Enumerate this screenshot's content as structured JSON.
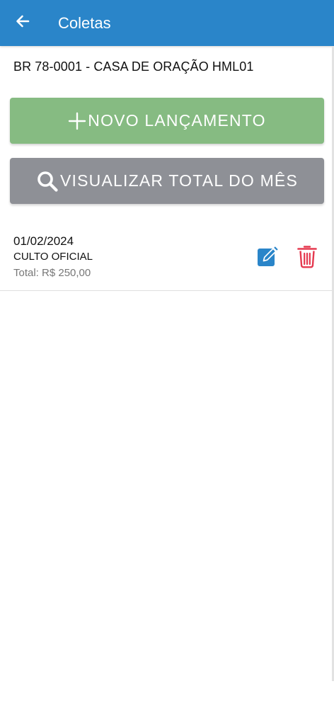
{
  "header": {
    "title": "Coletas",
    "back_icon": "arrow-left-icon",
    "background": "#2a85c9"
  },
  "church": {
    "label": "BR 78-0001 - CASA DE ORAÇÃO HML01"
  },
  "actions": {
    "new_entry_label": "NOVO LANÇAMENTO",
    "new_entry_icon": "plus-icon",
    "new_entry_color": "#86bb82",
    "month_total_label": "VISUALIZAR TOTAL DO MÊS",
    "month_total_icon": "search-icon",
    "month_total_color": "#8e9096"
  },
  "entries": [
    {
      "date": "01/02/2024",
      "type": "CULTO OFICIAL",
      "total": "Total: R$ 250,00",
      "edit_icon": "edit-icon",
      "delete_icon": "trash-icon",
      "edit_color": "#2a85c9",
      "delete_color": "#e5394f"
    }
  ]
}
